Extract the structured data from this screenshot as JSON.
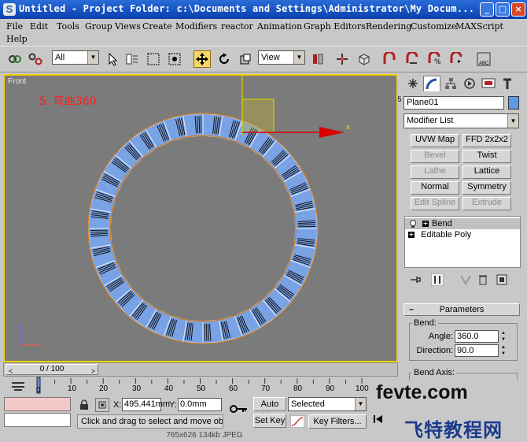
{
  "window": {
    "title": "Untitled    - Project Folder: c:\\Documents and Settings\\Administrator\\My Docum...",
    "minimize": "_",
    "maximize": "□",
    "close": "×"
  },
  "menu": {
    "items": [
      "File",
      "Edit",
      "Tools",
      "Group",
      "Views",
      "Create",
      "Modifiers",
      "reactor",
      "Animation",
      "Graph Editors",
      "Rendering",
      "Customize",
      "MAXScript",
      "Help"
    ]
  },
  "toolbar": {
    "selection_filter": "All",
    "reference_coord": "View",
    "snap_25": "2.5",
    "snap_n": "n",
    "abc_label": "ABC"
  },
  "viewport": {
    "label": "Front",
    "annotation": "5. 弯曲360",
    "gizmo_x_label": "x",
    "segment_count": 36,
    "colors": {
      "background": "#7b7b7b",
      "tile": "#7aa3e6",
      "ring_outline": "#d07b1e",
      "gizmo_x": "#d80000",
      "gizmo_y": "#e0d800",
      "border": "#f2d000"
    }
  },
  "command_panel": {
    "object_name": "Plane01",
    "object_color": "#5f9ae6",
    "modifier_list": "Modifier List",
    "modifier_buttons": [
      {
        "label": "UVW Map",
        "enabled": true
      },
      {
        "label": "FFD 2x2x2",
        "enabled": true
      },
      {
        "label": "Bevel",
        "enabled": false
      },
      {
        "label": "Twist",
        "enabled": true
      },
      {
        "label": "Lathe",
        "enabled": false
      },
      {
        "label": "Lattice",
        "enabled": true
      },
      {
        "label": "Normal",
        "enabled": true
      },
      {
        "label": "Symmetry",
        "enabled": true
      },
      {
        "label": "Edit Spline",
        "enabled": false
      },
      {
        "label": "Extrude",
        "enabled": false
      }
    ],
    "stack": [
      {
        "label": "Bend",
        "selected": true
      },
      {
        "label": "Editable Poly",
        "selected": false
      }
    ],
    "parameters": {
      "rollout_title": "Parameters",
      "bend_group": "Bend:",
      "angle_label": "Angle:",
      "angle_value": "360.0",
      "direction_label": "Direction:",
      "direction_value": "90.0",
      "bend_axis_group": "Bend Axis:"
    }
  },
  "timeline": {
    "slider_label": "0 / 100",
    "current_frame": 0,
    "ticks": [
      "0",
      "10",
      "20",
      "30",
      "40",
      "50",
      "60",
      "70",
      "80",
      "90",
      "100"
    ]
  },
  "status": {
    "x_label": "X:",
    "x_value": "495.441mm",
    "y_label": "Y:",
    "y_value": "0.0mm",
    "prompt": "Click and drag to select and move objects",
    "auto_key": "Auto Key",
    "set_key": "Set Key",
    "key_mode": "Selected",
    "key_filters": "Key Filters..."
  },
  "image_caption": "765x626  134kb  JPEG",
  "watermark": {
    "top": "fevte.com",
    "bottom": "飞特教程网"
  }
}
